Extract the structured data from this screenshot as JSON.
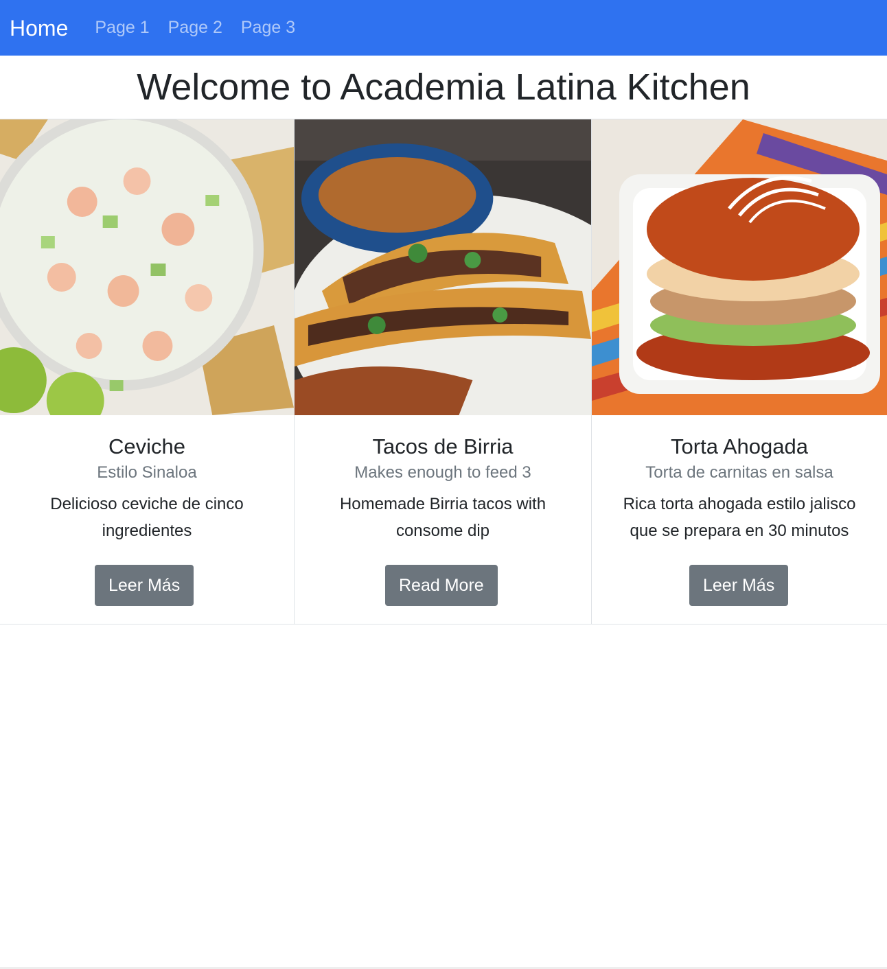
{
  "navbar": {
    "brand": "Home",
    "links": [
      {
        "label": "Page 1"
      },
      {
        "label": "Page 2"
      },
      {
        "label": "Page 3"
      }
    ],
    "background": "#2f72f0"
  },
  "main": {
    "heading": "Welcome to Academia Latina Kitchen"
  },
  "cards": [
    {
      "title": "Ceviche",
      "subtitle": "Estilo Sinaloa",
      "text": "Delicioso ceviche de cinco ingredientes",
      "button": "Leer Más"
    },
    {
      "title": "Tacos de Birria",
      "subtitle": "Makes enough to feed 3",
      "text": "Homemade Birria tacos with consome dip",
      "button": "Read More"
    },
    {
      "title": "Torta Ahogada",
      "subtitle": "Torta de carnitas en salsa",
      "text": "Rica torta ahogada estilo jalisco que se prepara en 30 minutos",
      "button": "Leer Más"
    }
  ],
  "colors": {
    "button": "#6c757d",
    "muted_text": "#6c757d",
    "body_text": "#212529"
  }
}
